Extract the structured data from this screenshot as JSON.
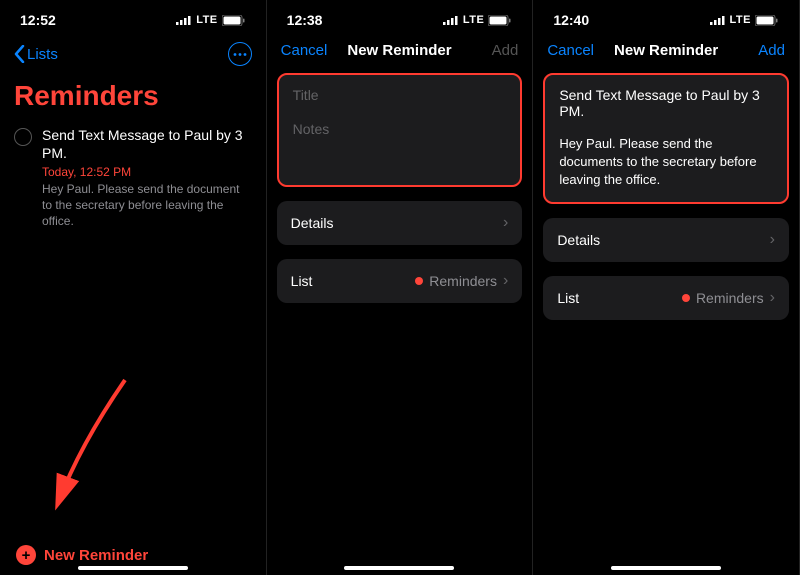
{
  "status": {
    "time1": "12:52",
    "time2": "12:38",
    "time3": "12:40",
    "carrier": "LTE"
  },
  "screen1": {
    "back_label": "Lists",
    "title": "Reminders",
    "item": {
      "title": "Send Text Message to Paul by 3 PM.",
      "due": "Today, 12:52 PM",
      "notes": "Hey Paul. Please send the document to the secretary before leaving the office."
    },
    "new_reminder_label": "New Reminder"
  },
  "screen2": {
    "cancel": "Cancel",
    "title": "New Reminder",
    "add": "Add",
    "title_placeholder": "Title",
    "notes_placeholder": "Notes",
    "details_label": "Details",
    "list_label": "List",
    "list_value": "Reminders"
  },
  "screen3": {
    "cancel": "Cancel",
    "title": "New Reminder",
    "add": "Add",
    "title_value": "Send Text Message to Paul by 3 PM.",
    "notes_value": "Hey Paul. Please send the documents to the secretary before leaving the office.",
    "details_label": "Details",
    "list_label": "List",
    "list_value": "Reminders"
  }
}
